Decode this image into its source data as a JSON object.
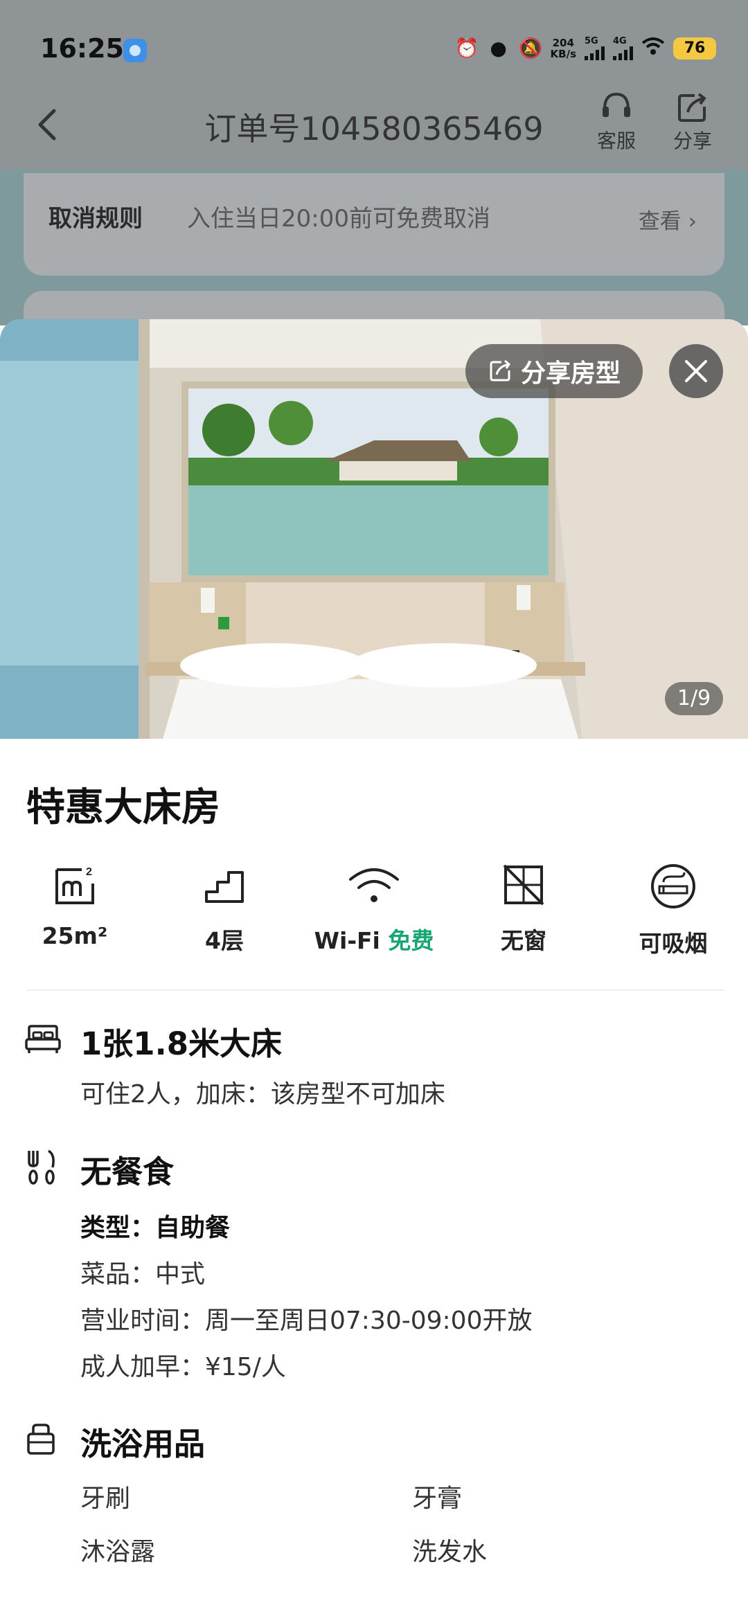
{
  "status_bar": {
    "time": "16:25",
    "net_speed_value": "204",
    "net_speed_unit": "KB/s",
    "sig1_label": "5G",
    "sig2_label": "4G",
    "battery": "76"
  },
  "nav": {
    "order_title": "订单号104580365469",
    "service_label": "客服",
    "share_label": "分享"
  },
  "cancel_policy": {
    "label": "取消规则",
    "text": "入住当日20:00前可免费取消",
    "view": "查看"
  },
  "photo": {
    "share_room_label": "分享房型",
    "counter": "1/9"
  },
  "room": {
    "title": "特惠大床房",
    "features": [
      {
        "icon": "area-icon",
        "label": "25m²"
      },
      {
        "icon": "stairs-icon",
        "label": "4层"
      },
      {
        "icon": "wifi-icon",
        "label": "Wi-Fi",
        "extra": "免费",
        "extra_color": "#17a672"
      },
      {
        "icon": "no-window-icon",
        "label": "无窗"
      },
      {
        "icon": "smoking-icon",
        "label": "可吸烟"
      }
    ]
  },
  "bed": {
    "icon": "bed-icon",
    "title": "1张1.8米大床",
    "detail": "可住2人，加床：该房型不可加床"
  },
  "meal": {
    "icon": "cutlery-icon",
    "title": "无餐食",
    "type": "类型：自助餐",
    "cuisine": "菜品：中式",
    "hours": "营业时间：周一至周日07:30-09:00开放",
    "adult_breakfast": "成人加早：¥15/人"
  },
  "toiletries": {
    "icon": "toiletries-icon",
    "title": "洗浴用品",
    "items": [
      "牙刷",
      "牙膏",
      "沐浴露",
      "洗发水"
    ]
  }
}
